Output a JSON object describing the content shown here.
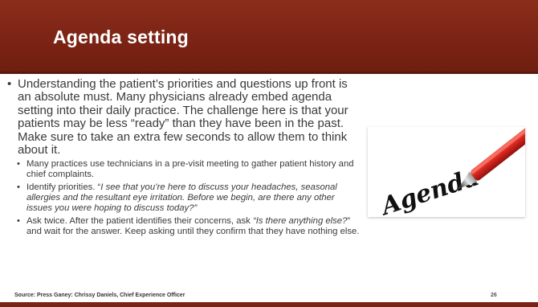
{
  "slide": {
    "title": "Agenda setting",
    "main_bullet": "Understanding the patient’s priorities and questions up front is an absolute must. Many physicians already embed agenda setting into their daily practice. The challenge here is that your patients may be less “ready” than they have been in the past. Make sure to take an extra few seconds to allow them to think about it.",
    "sub_bullets": [
      {
        "plain": "Many practices use technicians in a pre-visit meeting to gather patient history and chief complaints."
      },
      {
        "prefix": "Identify priorities. “",
        "italic": "I see that you’re here to discuss your headaches, seasonal allergies and the resultant eye irritation. Before we begin, are there any other issues you were hoping to discuss today?”"
      },
      {
        "prefix": "Ask twice. After the patient identifies their concerns, ask ",
        "italic": "“Is there anything else?",
        "suffix": "” and wait for the answer. Keep asking until they confirm that they have nothing else."
      }
    ],
    "source": "Source: Press Ganey: Chrissy Daniels, Chief Experience Officer",
    "page_number": "26",
    "image_text": "Agenda"
  },
  "colors": {
    "title_bar": "#7a2314",
    "title_text": "#ffffff",
    "body_text": "#3a3a3a",
    "pen_red": "#d8261f"
  }
}
